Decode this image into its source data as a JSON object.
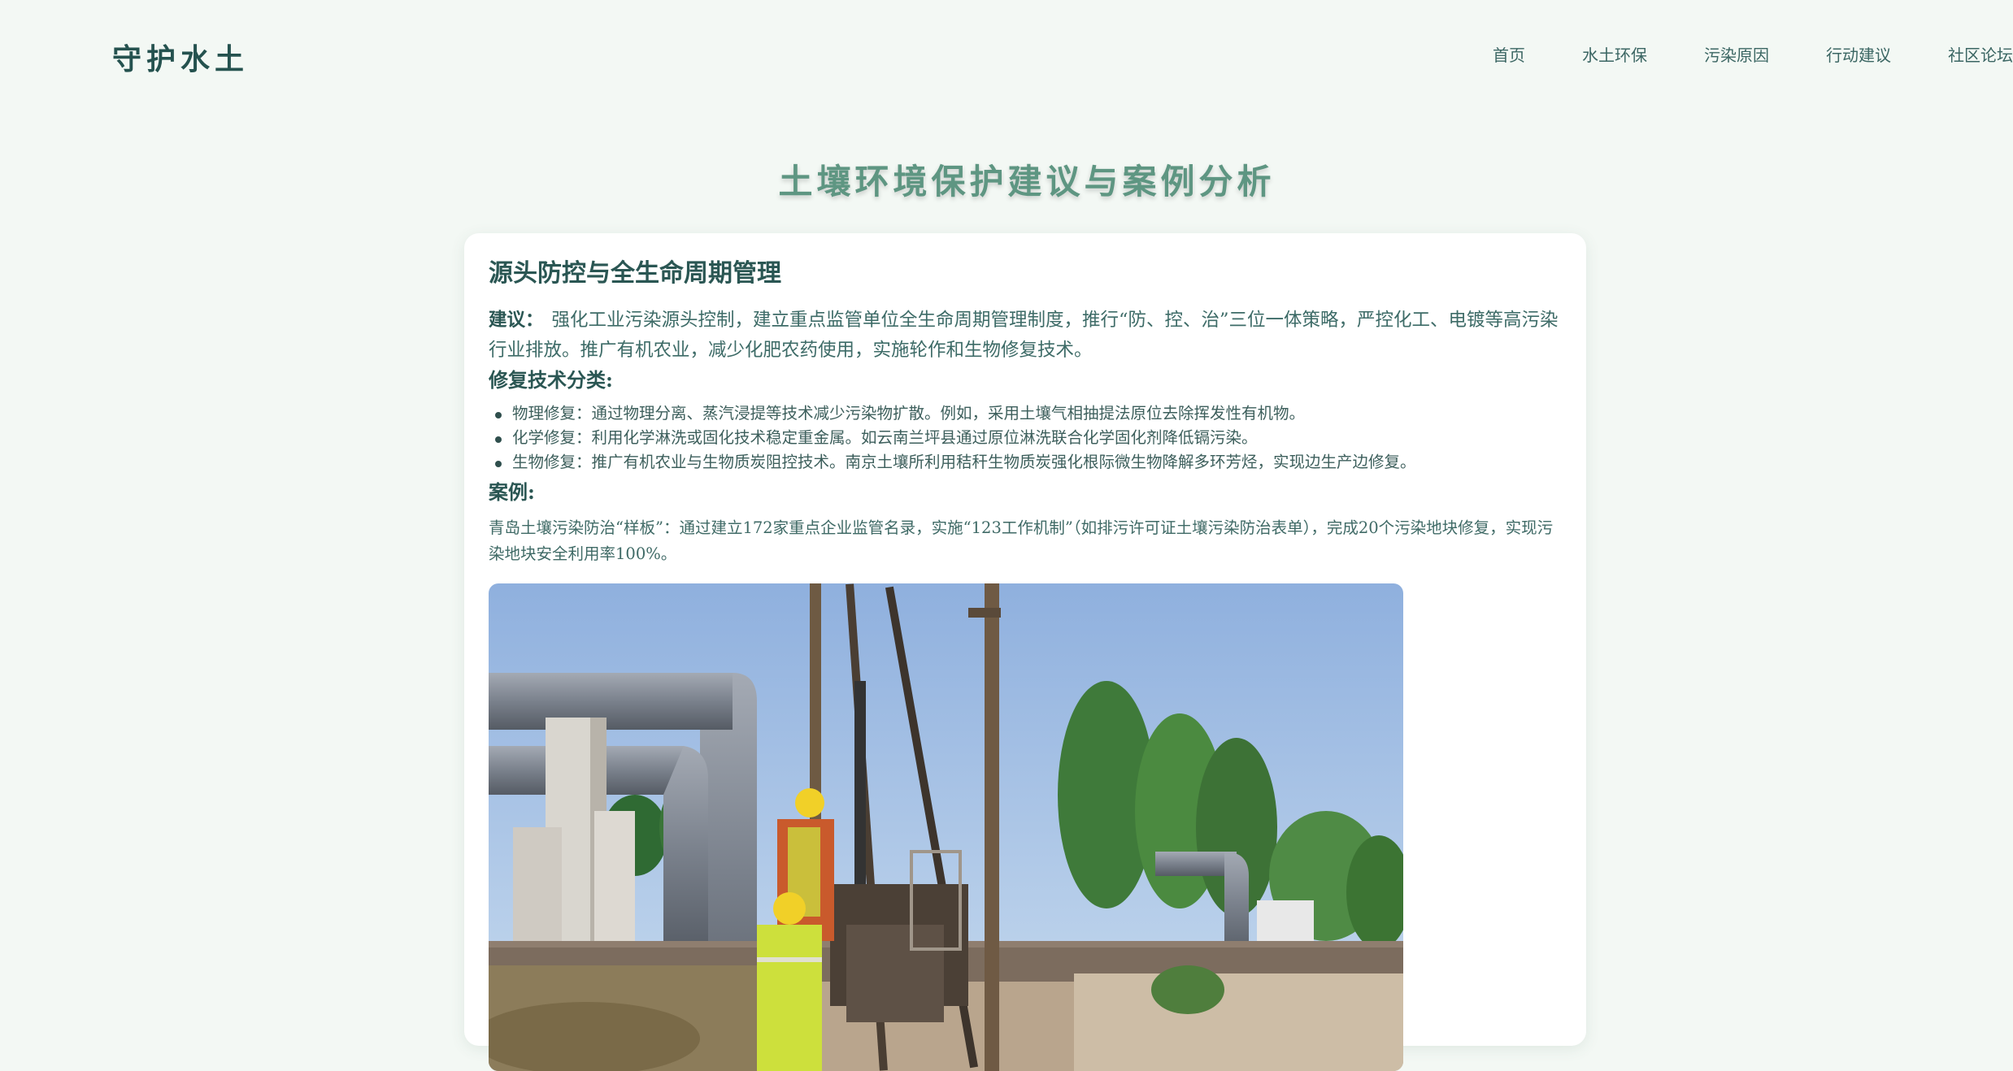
{
  "header": {
    "logo": "守护水土",
    "nav": [
      "首页",
      "水土环保",
      "污染原因",
      "行动建议",
      "社区论坛"
    ]
  },
  "page_title": "土壤环境保护建议与案例分析",
  "section": {
    "title": "源头防控与全生命周期管理",
    "advice_label": "建议：",
    "advice_text": "强化工业污染源头控制，建立重点监管单位全生命周期管理制度，推行“防、控、治”三位一体策略，严控化工、电镀等高污染行业排放。推广有机农业，减少化肥农药使用，实施轮作和生物修复技术。",
    "tech_heading": "修复技术分类:",
    "tech_items": [
      "物理修复：通过物理分离、蒸汽浸提等技术减少污染物扩散。例如，采用土壤气相抽提法原位去除挥发性有机物。",
      "化学修复：利用化学淋洗或固化技术稳定重金属。如云南兰坪县通过原位淋洗联合化学固化剂降低镉污染。",
      "生物修复：推广有机农业与生物质炭阻控技术。南京土壤所利用秸秆生物质炭强化根际微生物降解多环芳烃，实现边生产边修复。"
    ],
    "case_heading": "案例:",
    "case_text": "青岛土壤污染防治“样板”：通过建立172家重点企业监管名录，实施“123工作机制”（如排污许可证土壤污染防治表单），完成20个污染地块修复，实现污染地块安全利用率100%。"
  },
  "colors": {
    "background": "#f3f8f4",
    "card": "#ffffff",
    "title": "#5e9682",
    "text": "#2e5a57"
  }
}
